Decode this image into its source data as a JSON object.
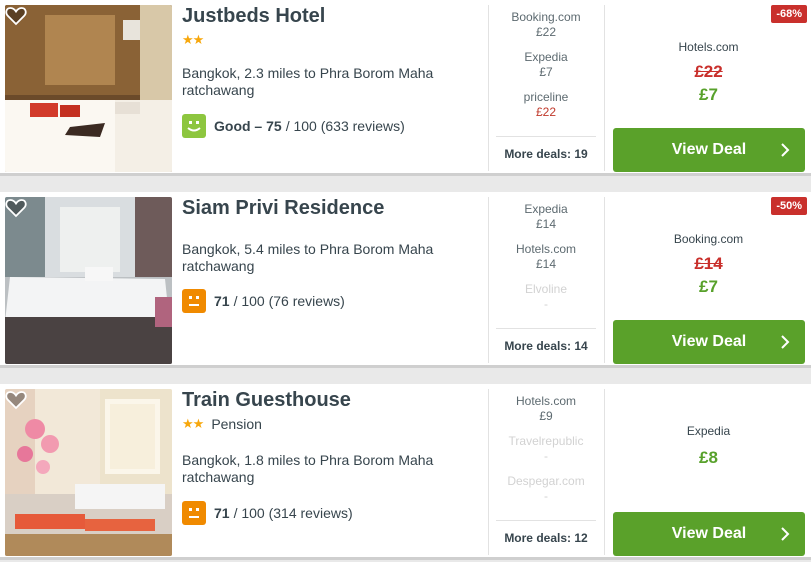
{
  "hotels": [
    {
      "name": "Justbeds Hotel",
      "stars": 2,
      "type": "",
      "location": "Bangkok, 2.3 miles to Phra Borom Maha ratchawang",
      "rating": {
        "label": "Good –",
        "score": "75",
        "rest": "/ 100 (633 reviews)",
        "face": "green"
      },
      "deals": [
        {
          "name": "Booking.com",
          "price": "£22",
          "style": "normal"
        },
        {
          "name": "Expedia",
          "price": "£7",
          "style": "normal"
        },
        {
          "name": "priceline",
          "price": "£22",
          "style": "red"
        }
      ],
      "more_deals": "More deals: 19",
      "discount": "-68%",
      "best": {
        "provider": "Hotels.com",
        "old_price": "£22",
        "price": "£7"
      },
      "button": "View Deal"
    },
    {
      "name": "Siam Privi Residence",
      "stars": 0,
      "type": "",
      "location": "Bangkok, 5.4 miles to Phra Borom Maha ratchawang",
      "rating": {
        "label": "",
        "score": "71",
        "rest": "/ 100 (76 reviews)",
        "face": "orange"
      },
      "deals": [
        {
          "name": "Expedia",
          "price": "£14",
          "style": "normal"
        },
        {
          "name": "Hotels.com",
          "price": "£14",
          "style": "normal"
        },
        {
          "name": "Elvoline",
          "price": "-",
          "style": "inactive"
        }
      ],
      "more_deals": "More deals: 14",
      "discount": "-50%",
      "best": {
        "provider": "Booking.com",
        "old_price": "£14",
        "price": "£7"
      },
      "button": "View Deal"
    },
    {
      "name": "Train Guesthouse",
      "stars": 2,
      "type": "Pension",
      "location": "Bangkok, 1.8 miles to Phra Borom Maha ratchawang",
      "rating": {
        "label": "",
        "score": "71",
        "rest": "/ 100 (314 reviews)",
        "face": "orange"
      },
      "deals": [
        {
          "name": "Hotels.com",
          "price": "£9",
          "style": "normal"
        },
        {
          "name": "Travelrepublic",
          "price": "-",
          "style": "inactive"
        },
        {
          "name": "Despegar.com",
          "price": "-",
          "style": "inactive"
        }
      ],
      "more_deals": "More deals: 12",
      "discount": "",
      "best": {
        "provider": "Expedia",
        "old_price": "",
        "price": "£8"
      },
      "button": "View Deal"
    }
  ],
  "icons": {
    "favorite": "heart-icon",
    "chevron": "chevron-right-icon",
    "rating_face": "smiley-face-icon"
  },
  "colors": {
    "accent_green": "#5aa12a",
    "discount_red": "#c9302c",
    "star": "#f7a70c"
  }
}
